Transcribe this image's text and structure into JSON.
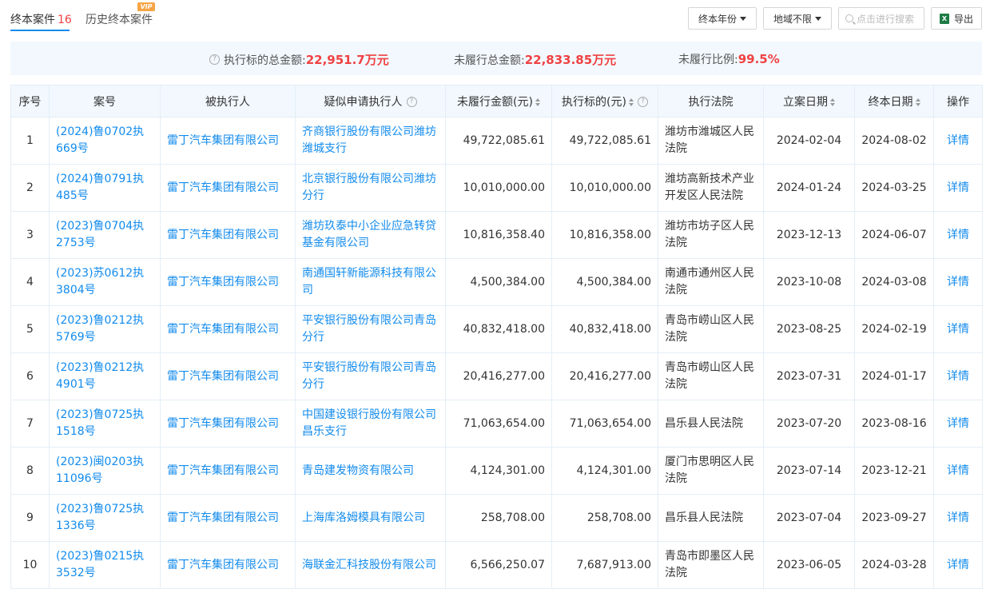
{
  "tabs": {
    "active_label": "终本案件",
    "active_count": "16",
    "history_label": "历史终本案件",
    "vip_badge": "VIP"
  },
  "filters": {
    "year_label": "终本年份",
    "region_label": "地域不限",
    "search_placeholder": "点击进行搜索",
    "export_label": "导出",
    "export_icon": "excel-icon"
  },
  "summary": {
    "total_label": "执行标的总金额:",
    "total_value": "22,951.7万元",
    "unpaid_label": "未履行总金额:",
    "unpaid_value": "22,833.85万元",
    "ratio_label": "未履行比例:",
    "ratio_value": "99.5%"
  },
  "table": {
    "headers": [
      "序号",
      "案号",
      "被执行人",
      "疑似申请执行人",
      "未履行金额(元)",
      "执行标的(元)",
      "执行法院",
      "立案日期",
      "终本日期",
      "操作"
    ],
    "rows": [
      {
        "idx": "1",
        "case_no": "(2024)鲁0702执669号",
        "debtor": "雷丁汽车集团有限公司",
        "applicant": "齐商银行股份有限公司潍坊潍城支行",
        "unpaid": "49,722,085.61",
        "target": "49,722,085.61",
        "court": "潍坊市潍城区人民法院",
        "filed": "2024-02-04",
        "ended": "2024-08-02",
        "action": "详情"
      },
      {
        "idx": "2",
        "case_no": "(2024)鲁0791执485号",
        "debtor": "雷丁汽车集团有限公司",
        "applicant": "北京银行股份有限公司潍坊分行",
        "unpaid": "10,010,000.00",
        "target": "10,010,000.00",
        "court": "潍坊高新技术产业开发区人民法院",
        "filed": "2024-01-24",
        "ended": "2024-03-25",
        "action": "详情"
      },
      {
        "idx": "3",
        "case_no": "(2023)鲁0704执2753号",
        "debtor": "雷丁汽车集团有限公司",
        "applicant": "潍坊玖泰中小企业应急转贷基金有限公司",
        "unpaid": "10,816,358.40",
        "target": "10,816,358.00",
        "court": "潍坊市坊子区人民法院",
        "filed": "2023-12-13",
        "ended": "2024-06-07",
        "action": "详情"
      },
      {
        "idx": "4",
        "case_no": "(2023)苏0612执3804号",
        "debtor": "雷丁汽车集团有限公司",
        "applicant": "南通国轩新能源科技有限公司",
        "unpaid": "4,500,384.00",
        "target": "4,500,384.00",
        "court": "南通市通州区人民法院",
        "filed": "2023-10-08",
        "ended": "2024-03-08",
        "action": "详情"
      },
      {
        "idx": "5",
        "case_no": "(2023)鲁0212执5769号",
        "debtor": "雷丁汽车集团有限公司",
        "applicant": "平安银行股份有限公司青岛分行",
        "unpaid": "40,832,418.00",
        "target": "40,832,418.00",
        "court": "青岛市崂山区人民法院",
        "filed": "2023-08-25",
        "ended": "2024-02-19",
        "action": "详情"
      },
      {
        "idx": "6",
        "case_no": "(2023)鲁0212执4901号",
        "debtor": "雷丁汽车集团有限公司",
        "applicant": "平安银行股份有限公司青岛分行",
        "unpaid": "20,416,277.00",
        "target": "20,416,277.00",
        "court": "青岛市崂山区人民法院",
        "filed": "2023-07-31",
        "ended": "2024-01-17",
        "action": "详情"
      },
      {
        "idx": "7",
        "case_no": "(2023)鲁0725执1518号",
        "debtor": "雷丁汽车集团有限公司",
        "applicant": "中国建设银行股份有限公司昌乐支行",
        "unpaid": "71,063,654.00",
        "target": "71,063,654.00",
        "court": "昌乐县人民法院",
        "filed": "2023-07-20",
        "ended": "2023-08-16",
        "action": "详情"
      },
      {
        "idx": "8",
        "case_no": "(2023)闽0203执11096号",
        "debtor": "雷丁汽车集团有限公司",
        "applicant": "青岛建发物资有限公司",
        "unpaid": "4,124,301.00",
        "target": "4,124,301.00",
        "court": "厦门市思明区人民法院",
        "filed": "2023-07-14",
        "ended": "2023-12-21",
        "action": "详情"
      },
      {
        "idx": "9",
        "case_no": "(2023)鲁0725执1336号",
        "debtor": "雷丁汽车集团有限公司",
        "applicant": "上海库洛姆模具有限公司",
        "unpaid": "258,708.00",
        "target": "258,708.00",
        "court": "昌乐县人民法院",
        "filed": "2023-07-04",
        "ended": "2023-09-27",
        "action": "详情"
      },
      {
        "idx": "10",
        "case_no": "(2023)鲁0215执3532号",
        "debtor": "雷丁汽车集团有限公司",
        "applicant": "海联金汇科技股份有限公司",
        "unpaid": "6,566,250.07",
        "target": "7,687,913.00",
        "court": "青岛市即墨区人民法院",
        "filed": "2023-06-05",
        "ended": "2024-03-28",
        "action": "详情"
      }
    ]
  },
  "colors": {
    "accent": "#128bed",
    "highlight": "#f04142",
    "summary_bg": "#f2f8fe"
  }
}
